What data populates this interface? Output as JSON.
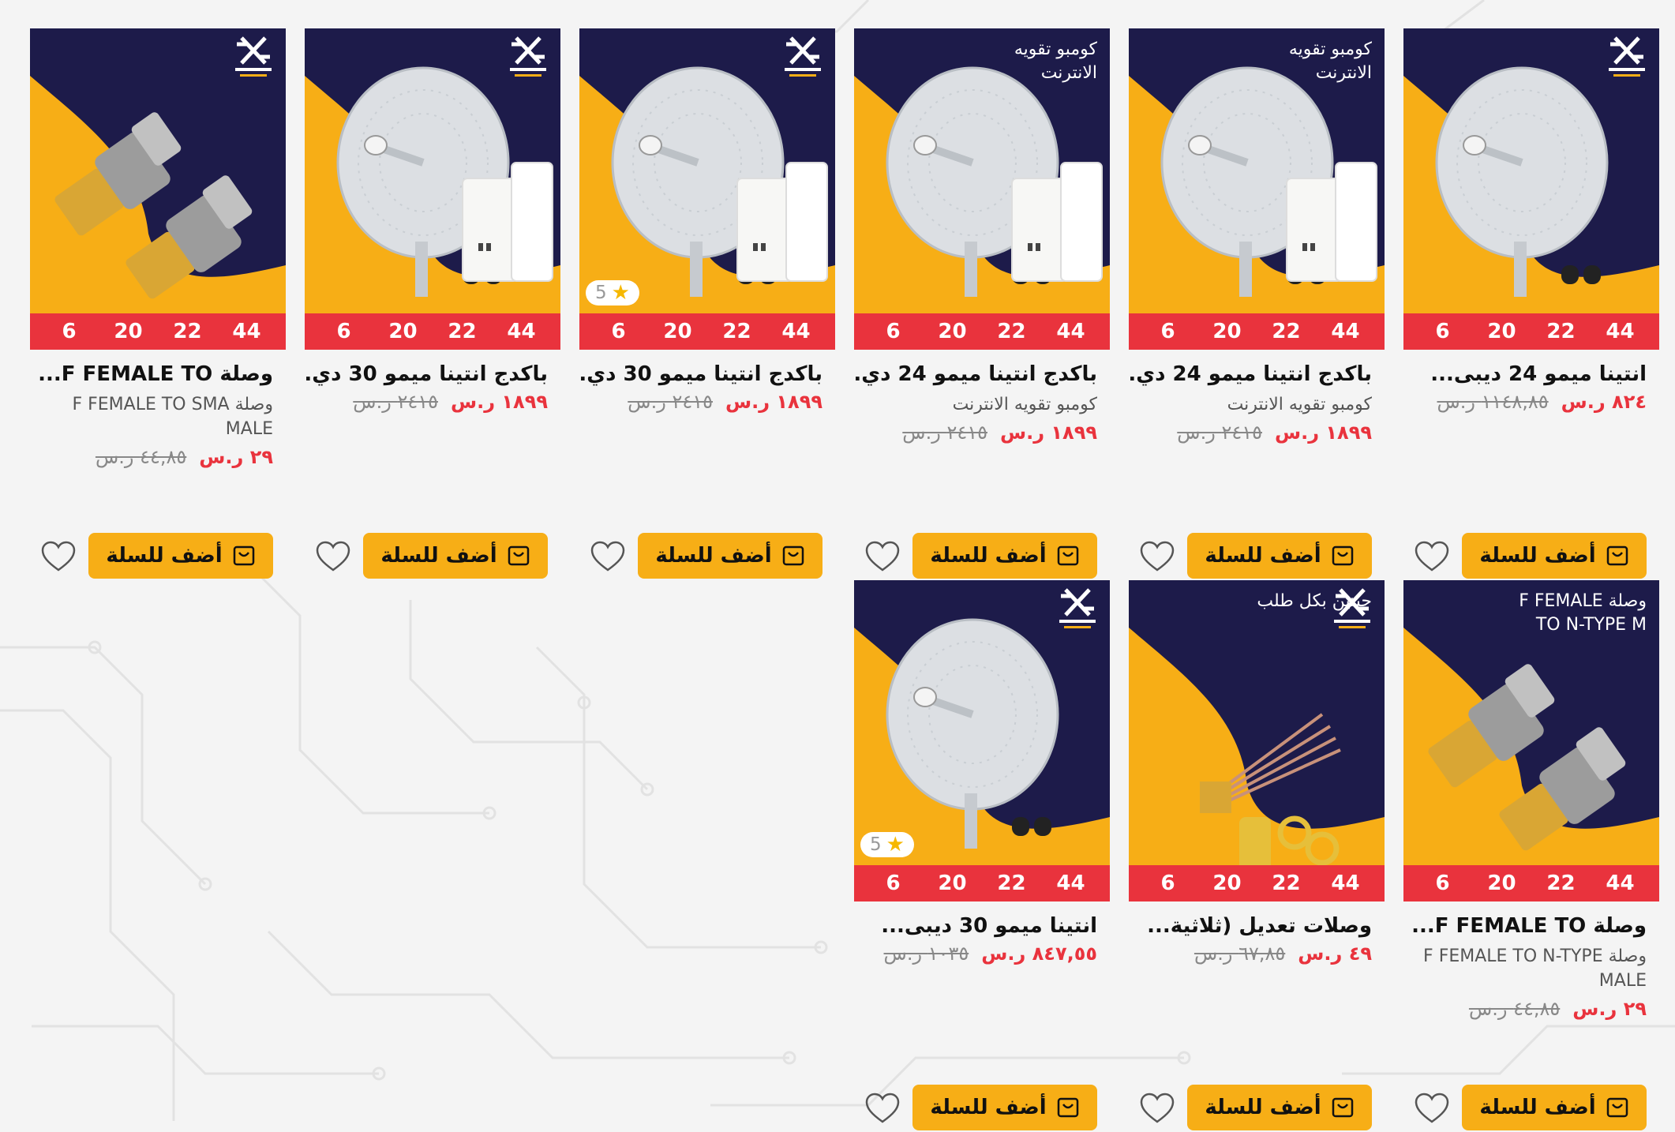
{
  "colors": {
    "accent": "#f7ae16",
    "sale": "#e9333d",
    "navy": "#1d1b4a"
  },
  "products": [
    {
      "title": "انتينا ميمو 24 ديبى...",
      "subtitle": "",
      "banner": "",
      "price": "٨٢٤ ر.س",
      "old_price": "١١٤٨,٨٥ ر.س",
      "rating": "",
      "logo": true,
      "product_icon": "dish-antenna-icon",
      "sizes": [
        "6",
        "20",
        "22",
        "44"
      ],
      "add_label": "أضف للسلة"
    },
    {
      "title": "باكدج انتينا ميمو 24 دي...",
      "subtitle": "كومبو تقويه الانترنت",
      "banner": "كومبو تقويه الانترنت",
      "price": "١٨٩٩ ر.س",
      "old_price": "٢٤١٥ ر.س",
      "rating": "",
      "logo": false,
      "product_icon": "dish-antenna-router-icon",
      "sizes": [
        "6",
        "20",
        "22",
        "44"
      ],
      "add_label": "أضف للسلة"
    },
    {
      "title": "باكدج انتينا ميمو 24 دي...",
      "subtitle": "كومبو تقويه الانترنت",
      "banner": "كومبو تقويه الانترنت",
      "price": "١٨٩٩ ر.س",
      "old_price": "٢٤١٥ ر.س",
      "rating": "",
      "logo": false,
      "product_icon": "dish-antenna-router-icon",
      "sizes": [
        "6",
        "20",
        "22",
        "44"
      ],
      "add_label": "أضف للسلة"
    },
    {
      "title": "باكدج انتينا ميمو 30 دي...",
      "subtitle": "",
      "banner": "",
      "price": "١٨٩٩ ر.س",
      "old_price": "٢٤١٥ ر.س",
      "rating": "5",
      "logo": true,
      "product_icon": "dish-antenna-router-icon",
      "sizes": [
        "6",
        "20",
        "22",
        "44"
      ],
      "add_label": "أضف للسلة"
    },
    {
      "title": "باكدج انتينا ميمو 30 دي...",
      "subtitle": "",
      "banner": "",
      "price": "١٨٩٩ ر.س",
      "old_price": "٢٤١٥ ر.س",
      "rating": "",
      "logo": true,
      "product_icon": "dish-antenna-router-icon",
      "sizes": [
        "6",
        "20",
        "22",
        "44"
      ],
      "add_label": "أضف للسلة"
    },
    {
      "title": "وصلة F FEMALE TO...",
      "subtitle": "وصلة F FEMALE TO SMA MALE",
      "banner": "",
      "price": "٢٩ ر.س",
      "old_price": "٤٤,٨٥ ر.س",
      "rating": "",
      "logo": true,
      "product_icon": "connector-adapter-icon",
      "sizes": [
        "6",
        "20",
        "22",
        "44"
      ],
      "add_label": "أضف للسلة"
    },
    {
      "title": "وصلة F FEMALE TO...",
      "subtitle": "وصلة F FEMALE TO N-TYPE MALE",
      "banner": "وصلة F FEMALE TO N-TYPE M",
      "price": "٢٩ ر.س",
      "old_price": "٤٤,٨٥ ر.س",
      "rating": "",
      "logo": false,
      "product_icon": "connector-adapter-icon",
      "sizes": [
        "6",
        "20",
        "22",
        "44"
      ],
      "add_label": "أضف للسلة"
    },
    {
      "title": "وصلات تعديل (ثلاثية...",
      "subtitle": "",
      "banner": "حبتين بكل طلب",
      "price": "٤٩ ر.س",
      "old_price": "٦٧,٨٥ ر.س",
      "rating": "",
      "logo": true,
      "product_icon": "pigtail-cable-icon",
      "sizes": [
        "6",
        "20",
        "22",
        "44"
      ],
      "add_label": "أضف للسلة"
    },
    {
      "title": "انتينا ميمو 30 ديبى...",
      "subtitle": "",
      "banner": "",
      "price": "٨٤٧,٥٥ ر.س",
      "old_price": "١٠٣٥ ر.س",
      "rating": "5",
      "logo": true,
      "product_icon": "dish-antenna-icon",
      "sizes": [
        "6",
        "20",
        "22",
        "44"
      ],
      "add_label": "أضف للسلة"
    }
  ]
}
